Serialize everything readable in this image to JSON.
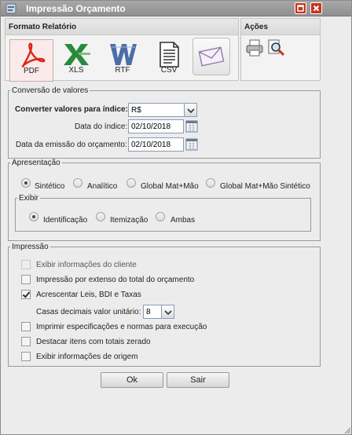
{
  "window": {
    "title": "Impressão Orçamento",
    "colors": {
      "titlebar": "#9a9a9a",
      "close": "#c8321e",
      "pdf": "#d9261c",
      "xls": "#2a8a3a",
      "rtf": "#4b6ea8"
    }
  },
  "toolbar": {
    "formats_title": "Formato Relatório",
    "formats": [
      {
        "label": "PDF",
        "icon": "pdf-icon",
        "selected": true
      },
      {
        "label": "XLS",
        "icon": "xls-icon"
      },
      {
        "label": "RTF",
        "icon": "rtf-icon"
      },
      {
        "label": "CSV",
        "icon": "csv-icon"
      },
      {
        "label": "",
        "icon": "email-icon"
      }
    ],
    "actions_title": "Ações",
    "actions": [
      {
        "icon": "printer-icon"
      },
      {
        "icon": "print-preview-icon"
      }
    ]
  },
  "conversion": {
    "legend": "Conversão de valores",
    "convert_label": "Converter valores para índice:",
    "convert_value": "R$",
    "index_date_label": "Data do índice:",
    "index_date_value": "02/10/2018",
    "emission_date_label": "Data da emissão do orçamento:",
    "emission_date_value": "02/10/2018"
  },
  "presentation": {
    "legend": "Apresentação",
    "options": [
      "Sintético",
      "Analítico",
      "Global Mat+Mão",
      "Global Mat+Mão Sintético"
    ],
    "selected": "Sintético",
    "exibir": {
      "legend": "Exibir",
      "options": [
        "Identificação",
        "Itemização",
        "Ambas"
      ],
      "selected": "Identificação"
    }
  },
  "printing": {
    "legend": "Impressão",
    "options": [
      {
        "label": "Exibir informações do cliente",
        "checked": false,
        "disabled": true
      },
      {
        "label": "Impressão por extenso do total do orçamento",
        "checked": false
      },
      {
        "label": "Acrescentar Leis, BDI e Taxas",
        "checked": true
      },
      {
        "label": "Imprimir especificações e normas para execução",
        "checked": false
      },
      {
        "label": "Destacar itens com totais zerado",
        "checked": false
      },
      {
        "label": "Exibir informações de origem",
        "checked": false
      }
    ],
    "decimals_label": "Casas decimais valor unitário:",
    "decimals_value": "8"
  },
  "buttons": {
    "ok": "Ok",
    "exit": "Sair"
  }
}
